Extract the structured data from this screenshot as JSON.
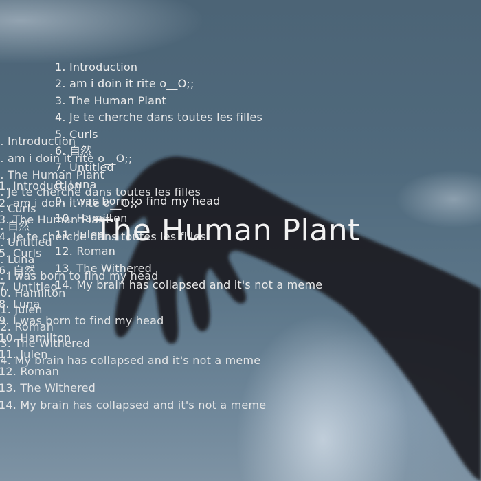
{
  "album_title": "The Human Plant",
  "tracks": [
    "1. Introduction",
    "2. am i doin it rite o__O;;",
    "3. The Human Plant",
    "4. Je te cherche dans toutes les filles",
    "5. Curls",
    "6. 自然",
    "7. Untitled",
    "8. Luna",
    "9. I was born to find my head",
    "10. Hamilton",
    "11. Julen",
    "12. Roman",
    "13. The Withered",
    "14. My brain has collapsed and it's not a meme"
  ],
  "colors": {
    "sky": "#556e80",
    "text": "#ebebeb",
    "silhouette": "#1c1c1f"
  }
}
